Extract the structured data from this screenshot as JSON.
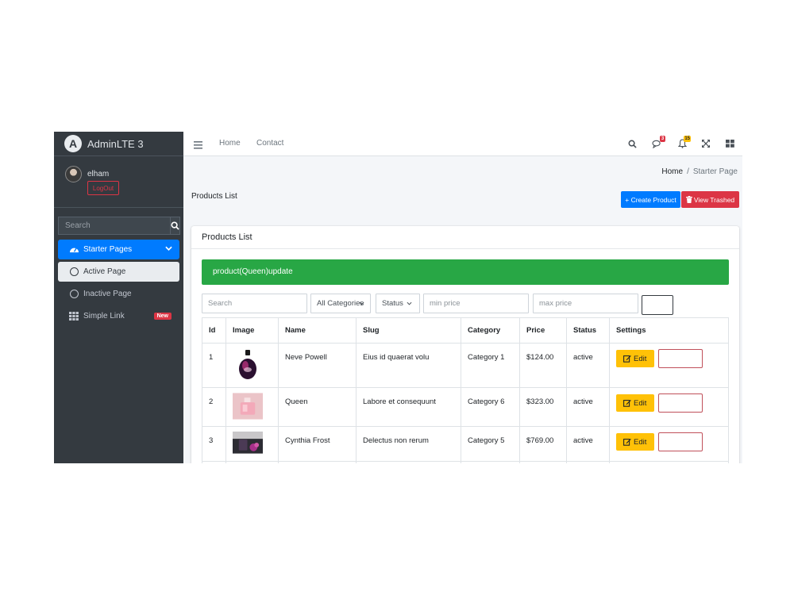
{
  "brand": {
    "title": "AdminLTE 3",
    "logo_letter": "A"
  },
  "user": {
    "name": "elham",
    "logout_label": "LogOut"
  },
  "sidebar": {
    "search_placeholder": "Search",
    "items": [
      {
        "label": "Starter Pages",
        "icon": "tachometer-icon"
      },
      {
        "label": "Active Page",
        "icon": "circle-icon"
      },
      {
        "label": "Inactive Page",
        "icon": "circle-icon"
      },
      {
        "label": "Simple Link",
        "icon": "grid-icon",
        "badge": "New"
      }
    ]
  },
  "topbar": {
    "links": [
      "Home",
      "Contact"
    ],
    "messages_count": "3",
    "notifications_count": "15",
    "badge_colors": {
      "messages": "#dc3545",
      "notifications": "#ffc107"
    }
  },
  "breadcrumb": {
    "home": "Home",
    "current": "Starter Page"
  },
  "page": {
    "title": "Products List",
    "create_label": "+ Create Product",
    "trash_label": "View Trashed"
  },
  "card": {
    "title": "Products List",
    "alert": "product(Queen)update",
    "filters": {
      "search_placeholder": "Search",
      "category_value": "All Categories",
      "status_value": "Status",
      "min_placeholder": "min price",
      "max_placeholder": "max price"
    },
    "table": {
      "headers": [
        "Id",
        "Image",
        "Name",
        "Slug",
        "Category",
        "Price",
        "Status",
        "Settings"
      ],
      "edit_label": "Edit",
      "rows": [
        {
          "id": "1",
          "name": "Neve Powell",
          "slug": "Eius id quaerat volu",
          "category": "Category 1",
          "price": "$124.00",
          "status": "active"
        },
        {
          "id": "2",
          "name": "Queen",
          "slug": "Labore et consequunt",
          "category": "Category 6",
          "price": "$323.00",
          "status": "active"
        },
        {
          "id": "3",
          "name": "Cynthia Frost",
          "slug": "Delectus non rerum",
          "category": "Category 5",
          "price": "$769.00",
          "status": "active"
        }
      ]
    }
  },
  "colors": {
    "primary": "#007bff",
    "danger": "#dc3545",
    "success": "#28a745",
    "warning": "#ffc107",
    "sidebar": "#343a40"
  }
}
